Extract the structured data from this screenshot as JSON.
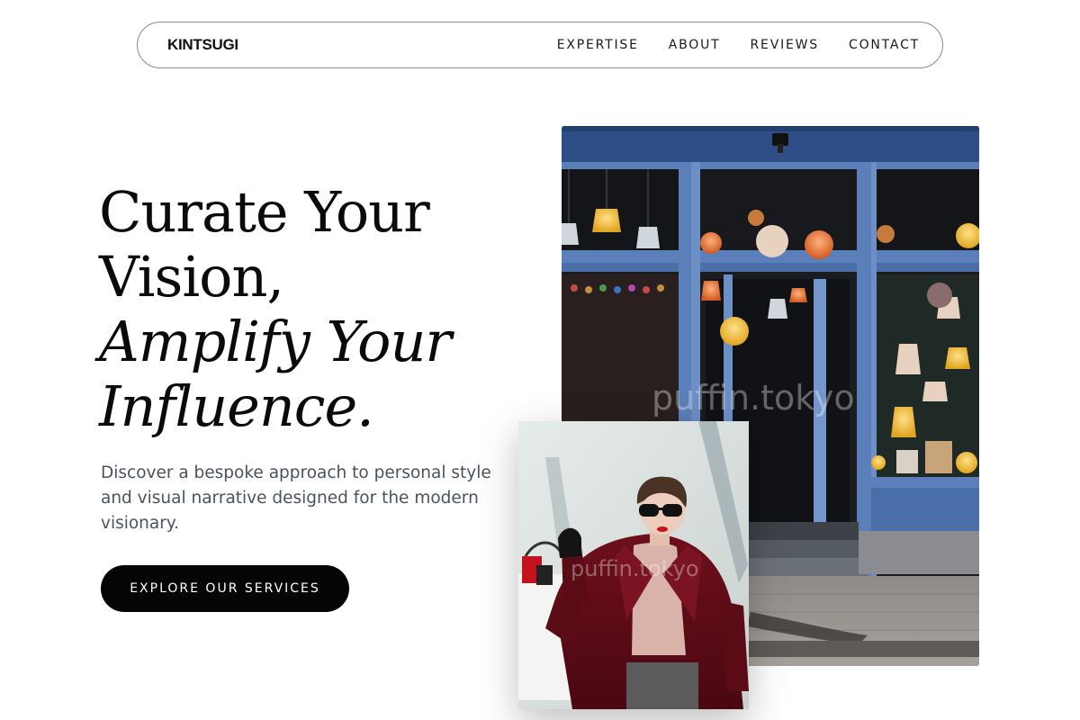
{
  "brand": "KINTSUGI",
  "nav": {
    "links": [
      "EXPERTISE",
      "ABOUT",
      "REVIEWS",
      "CONTACT"
    ]
  },
  "hero": {
    "headline_line1": "Curate Your",
    "headline_line2": "Vision,",
    "headline_line3": "Amplify Your",
    "headline_line4": "Influence.",
    "description": "Discover a bespoke approach to personal style and visual narrative designed for the modern visionary.",
    "cta_label": "EXPLORE OUR SERVICES"
  },
  "images": {
    "watermark": "puffin.tokyo"
  },
  "colors": {
    "accent": "#050505",
    "body_text": "#4a5260",
    "window_frame": "#4a6fa5"
  }
}
